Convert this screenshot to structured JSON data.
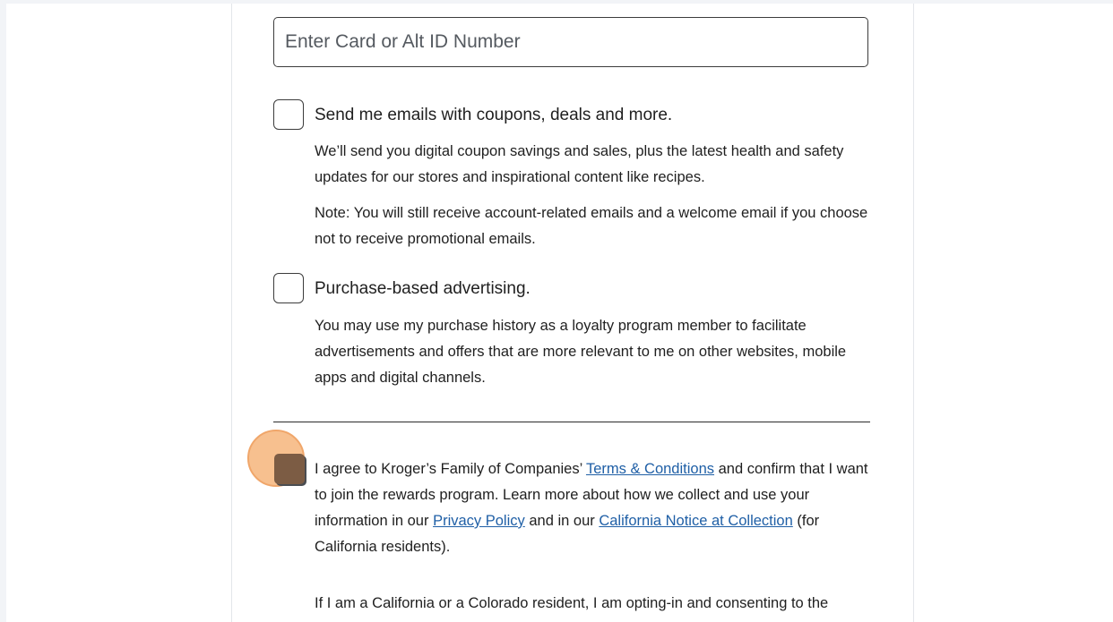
{
  "card_field": {
    "placeholder": "Enter Card or Alt ID Number",
    "value": ""
  },
  "email_option": {
    "checked": false,
    "title": "Send me emails with coupons, deals and more.",
    "description": "We’ll send you digital coupon savings and sales, plus the latest health and safety updates for our stores and inspirational content like recipes.",
    "note": "Note: You will still receive account-related emails and a welcome email if you choose not to receive promotional emails."
  },
  "advertising_option": {
    "checked": false,
    "title": "Purchase-based advertising.",
    "description": "You may use my purchase history as a loyalty program member to facilitate advertisements and offers that are more relevant to me on other websites, mobile apps and digital channels."
  },
  "agreement": {
    "checked": true,
    "text_1": "I agree to Kroger’s Family of Companies’ ",
    "terms_link": "Terms & Conditions",
    "text_2": " and confirm that I want to join the rewards program. Learn more about how we collect and use your information in our ",
    "privacy_link": "Privacy Policy",
    "text_3": " and in our ",
    "california_link": "California Notice at Collection",
    "text_4": " (for California residents)."
  },
  "consent_text": "If I am a California or a Colorado resident, I am opting-in and consenting to the",
  "colors": {
    "link": "#1f5fa6",
    "checked_box": "#7c5c44",
    "highlight": "#f5b276"
  }
}
